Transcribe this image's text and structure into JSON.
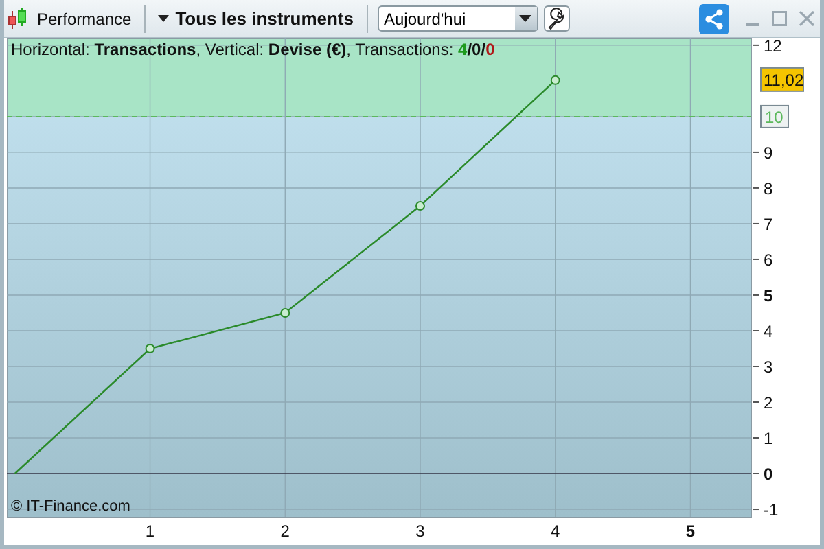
{
  "toolbar": {
    "title": "Performance",
    "instruments": "Tous les instruments",
    "period": "Aujourd'hui"
  },
  "chart_info": {
    "text": "Horizontal: **Transactions**, Vertical: **Devise (€)**, Transactions: ",
    "counts": [
      {
        "text": "4",
        "color": "#1e9a1e"
      },
      {
        "text": "0",
        "color": "#111111"
      },
      {
        "text": "0",
        "color": "#b01818"
      }
    ],
    "separator": "/"
  },
  "credit": "© IT-Finance.com",
  "chart": {
    "chart_data": {
      "type": "line",
      "x": [
        0,
        1,
        2,
        3,
        4
      ],
      "series": [
        {
          "color": "#2a8a2a",
          "marker": "o",
          "values": [
            0,
            3.5,
            4.5,
            7.5,
            11.02
          ]
        }
      ],
      "xlim": [
        -0.06,
        5.45
      ],
      "ylim": [
        -1.23,
        12.19
      ],
      "grid": true,
      "xticks": [
        1,
        2,
        3,
        4,
        5
      ],
      "yticks": [
        -1,
        0,
        1,
        2,
        3,
        4,
        5,
        6,
        7,
        8,
        9,
        10,
        12
      ],
      "bands": [
        {
          "axis": "y",
          "from": 10,
          "to": 12.19,
          "color": "#a8e4c6"
        }
      ],
      "ref_lines": [
        {
          "axis": "y",
          "value": 10,
          "color": "#5cb85c"
        }
      ],
      "annotations": [
        "11,02"
      ]
    }
  }
}
